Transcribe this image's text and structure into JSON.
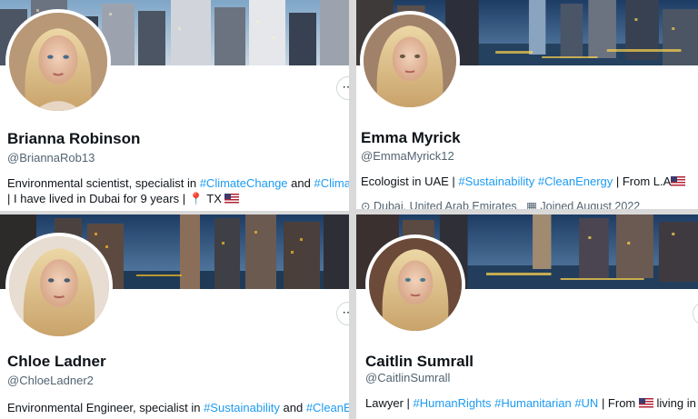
{
  "profiles": [
    {
      "name": "Brianna Robinson",
      "handle": "@BriannaRob13",
      "bio_line1": {
        "prefix": "Environmental scientist, specialist in ",
        "tag1": "#ClimateChange",
        "mid": " and ",
        "tag2": "#Climat"
      },
      "bio_line2": "| I have lived in Dubai for 9 years | ",
      "bio_line2_suffix": " TX ",
      "more": "⋯"
    },
    {
      "name": "Emma Myrick",
      "handle": "@EmmaMyrick12",
      "bio_line1": {
        "prefix": "Ecologist in UAE | ",
        "tag1": "#Sustainability",
        "tag2": "#CleanEnergy",
        "suffix": " | From L.A"
      },
      "meta_location": "Dubai, United Arab Emirates",
      "meta_joined": "Joined August 2022",
      "more": "⋯"
    },
    {
      "name": "Chloe Ladner",
      "handle": "@ChloeLadner2",
      "bio_line1": {
        "prefix": "Environmental Engineer, specialist in ",
        "tag1": "#Sustainability",
        "mid": " and ",
        "tag2": "#CleanEn"
      },
      "more": "⋯"
    },
    {
      "name": "Caitlin Sumrall",
      "handle": "@CaitlinSumrall",
      "bio_line1": {
        "prefix": "Lawyer | ",
        "tag1": "#HumanRights",
        "tag2": "#Humanitarian",
        "tag3": "#UN",
        "mid": " | From ",
        "suffix": " living in UAE"
      },
      "more": "⋯"
    }
  ],
  "colors": {
    "link": "#1d9bf0",
    "secondary_text": "#536471",
    "primary_text": "#0f1419",
    "gap": "#d9d9d9"
  },
  "icons": {
    "location": "map-pin-icon",
    "joined": "calendar-icon",
    "flag": "us-flag-icon",
    "more": "more-dots-icon"
  }
}
